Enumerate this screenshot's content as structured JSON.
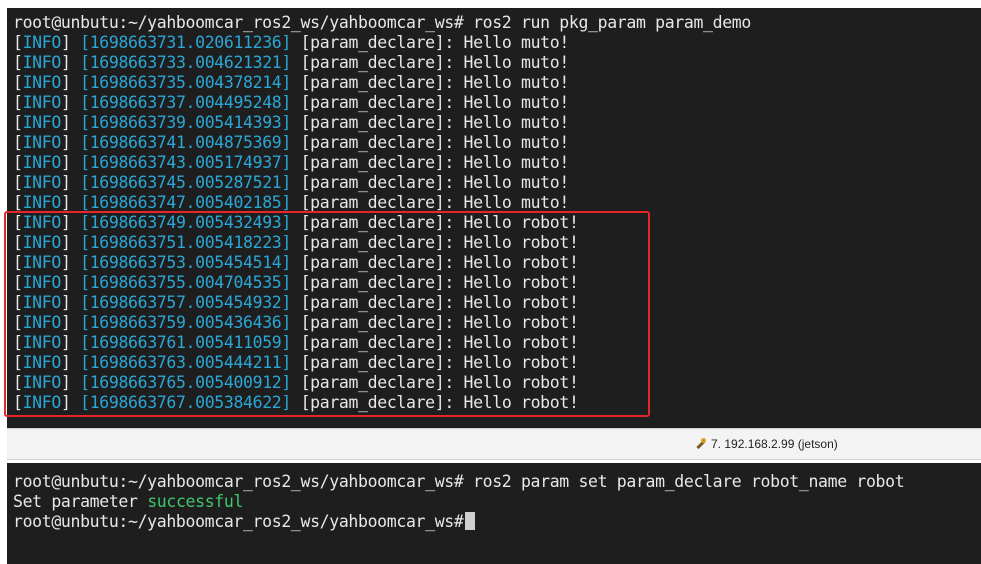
{
  "top_terminal": {
    "prompt": "root@unbutu:~/yahboomcar_ros2_ws/yahboomcar_ws#",
    "command": " ros2 run pkg_param param_demo",
    "log_lines": [
      {
        "level": "INFO",
        "timestamp": "1698663731.020611236",
        "node": "param_declare",
        "message": "Hello muto!"
      },
      {
        "level": "INFO",
        "timestamp": "1698663733.004621321",
        "node": "param_declare",
        "message": "Hello muto!"
      },
      {
        "level": "INFO",
        "timestamp": "1698663735.004378214",
        "node": "param_declare",
        "message": "Hello muto!"
      },
      {
        "level": "INFO",
        "timestamp": "1698663737.004495248",
        "node": "param_declare",
        "message": "Hello muto!"
      },
      {
        "level": "INFO",
        "timestamp": "1698663739.005414393",
        "node": "param_declare",
        "message": "Hello muto!"
      },
      {
        "level": "INFO",
        "timestamp": "1698663741.004875369",
        "node": "param_declare",
        "message": "Hello muto!"
      },
      {
        "level": "INFO",
        "timestamp": "1698663743.005174937",
        "node": "param_declare",
        "message": "Hello muto!"
      },
      {
        "level": "INFO",
        "timestamp": "1698663745.005287521",
        "node": "param_declare",
        "message": "Hello muto!"
      },
      {
        "level": "INFO",
        "timestamp": "1698663747.005402185",
        "node": "param_declare",
        "message": "Hello muto!"
      },
      {
        "level": "INFO",
        "timestamp": "1698663749.005432493",
        "node": "param_declare",
        "message": "Hello robot!"
      },
      {
        "level": "INFO",
        "timestamp": "1698663751.005418223",
        "node": "param_declare",
        "message": "Hello robot!"
      },
      {
        "level": "INFO",
        "timestamp": "1698663753.005454514",
        "node": "param_declare",
        "message": "Hello robot!"
      },
      {
        "level": "INFO",
        "timestamp": "1698663755.004704535",
        "node": "param_declare",
        "message": "Hello robot!"
      },
      {
        "level": "INFO",
        "timestamp": "1698663757.005454932",
        "node": "param_declare",
        "message": "Hello robot!"
      },
      {
        "level": "INFO",
        "timestamp": "1698663759.005436436",
        "node": "param_declare",
        "message": "Hello robot!"
      },
      {
        "level": "INFO",
        "timestamp": "1698663761.005411059",
        "node": "param_declare",
        "message": "Hello robot!"
      },
      {
        "level": "INFO",
        "timestamp": "1698663763.005444211",
        "node": "param_declare",
        "message": "Hello robot!"
      },
      {
        "level": "INFO",
        "timestamp": "1698663765.005400912",
        "node": "param_declare",
        "message": "Hello robot!"
      },
      {
        "level": "INFO",
        "timestamp": "1698663767.005384622",
        "node": "param_declare",
        "message": "Hello robot!"
      }
    ]
  },
  "status_bar": {
    "session_label": "7. 192.168.2.99 (jetson)",
    "session_icon": "wrench-icon"
  },
  "bottom_terminal": {
    "prompt": "root@unbutu:~/yahboomcar_ros2_ws/yahboomcar_ws#",
    "command": " ros2 param set param_declare robot_name robot",
    "result_prefix": "Set parameter ",
    "result_status": "successful",
    "prompt2": "root@unbutu:~/yahboomcar_ros2_ws/yahboomcar_ws#"
  },
  "colors": {
    "terminal_bg": "#1e1e1e",
    "log_level_timestamp": "#2aa7d6",
    "success": "#3ec86e",
    "highlight_border": "#e5262a"
  }
}
